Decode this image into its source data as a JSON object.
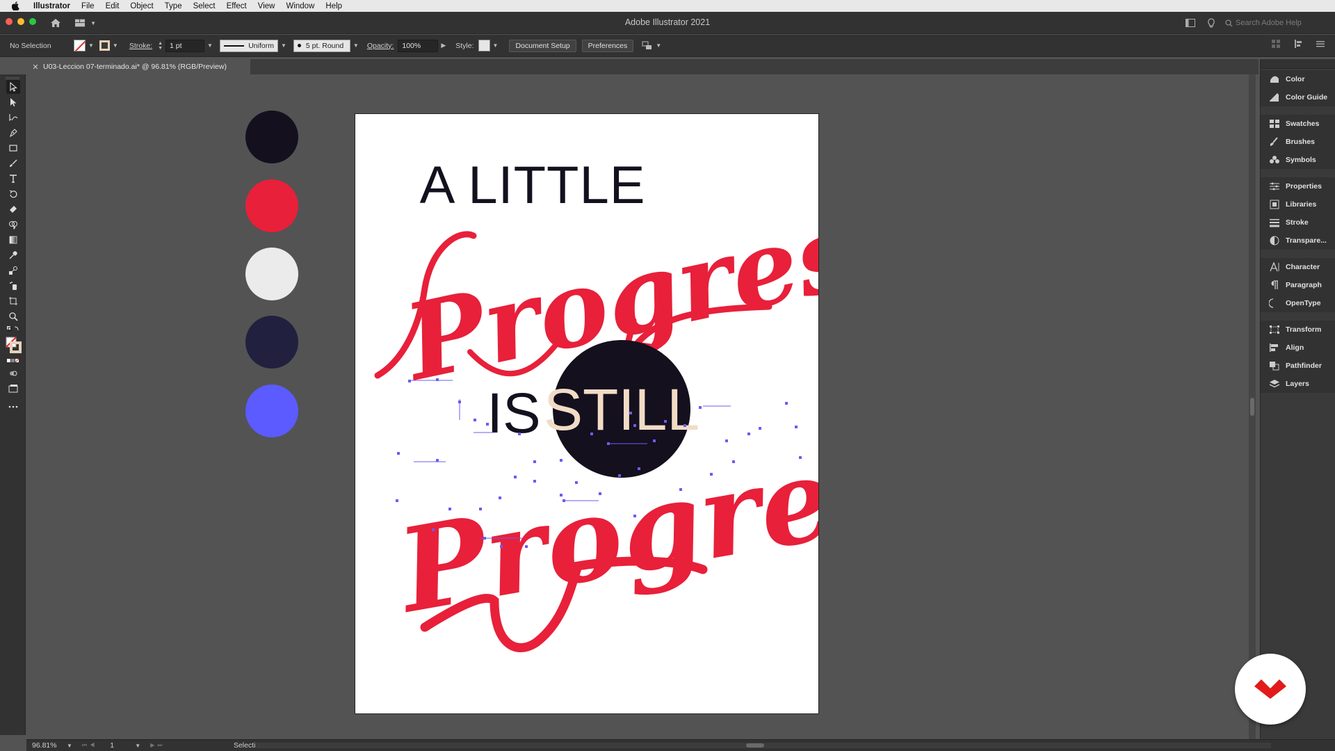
{
  "menubar": {
    "app_name": "Illustrator",
    "items": [
      "File",
      "Edit",
      "Object",
      "Type",
      "Select",
      "Effect",
      "View",
      "Window",
      "Help"
    ]
  },
  "titlebar": {
    "title": "Adobe Illustrator 2021",
    "search_placeholder": "Search Adobe Help"
  },
  "controlbar": {
    "selection": "No Selection",
    "stroke_label": "Stroke:",
    "stroke_value": "1 pt",
    "profile": "Uniform",
    "brush": "5 pt. Round",
    "opacity_label": "Opacity:",
    "opacity_value": "100%",
    "style_label": "Style:",
    "document_setup": "Document Setup",
    "preferences": "Preferences"
  },
  "document": {
    "tab_title": "U03-Leccion 07-terminado.ai* @ 96.81% (RGB/Preview)"
  },
  "palette_colors": [
    "#14101e",
    "#e8203a",
    "#ebebeb",
    "#22203f",
    "#5b5bff"
  ],
  "artwork": {
    "line1": "A LITTLE",
    "line2": "Progress",
    "line3_is": "IS",
    "line3_still": "STILL",
    "line4": "Progress",
    "red": "#e8203a",
    "dark": "#14101e",
    "cream": "#f2dcc6",
    "anchor_color": "#6b5cf2"
  },
  "panels": {
    "groups": [
      [
        {
          "label": "Color",
          "icon": "color-icon"
        },
        {
          "label": "Color Guide",
          "icon": "color-guide-icon"
        }
      ],
      [
        {
          "label": "Swatches",
          "icon": "swatches-icon"
        },
        {
          "label": "Brushes",
          "icon": "brushes-icon"
        },
        {
          "label": "Symbols",
          "icon": "symbols-icon"
        }
      ],
      [
        {
          "label": "Properties",
          "icon": "properties-icon"
        },
        {
          "label": "Libraries",
          "icon": "libraries-icon"
        },
        {
          "label": "Stroke",
          "icon": "stroke-icon"
        },
        {
          "label": "Transpare...",
          "icon": "transparency-icon"
        }
      ],
      [
        {
          "label": "Character",
          "icon": "character-icon"
        },
        {
          "label": "Paragraph",
          "icon": "paragraph-icon"
        },
        {
          "label": "OpenType",
          "icon": "opentype-icon"
        }
      ],
      [
        {
          "label": "Transform",
          "icon": "transform-icon"
        },
        {
          "label": "Align",
          "icon": "align-icon"
        },
        {
          "label": "Pathfinder",
          "icon": "pathfinder-icon"
        },
        {
          "label": "Layers",
          "icon": "layers-icon"
        }
      ]
    ]
  },
  "statusbar": {
    "zoom": "96.81%",
    "artboard_number": "1",
    "tool": "Selection"
  }
}
